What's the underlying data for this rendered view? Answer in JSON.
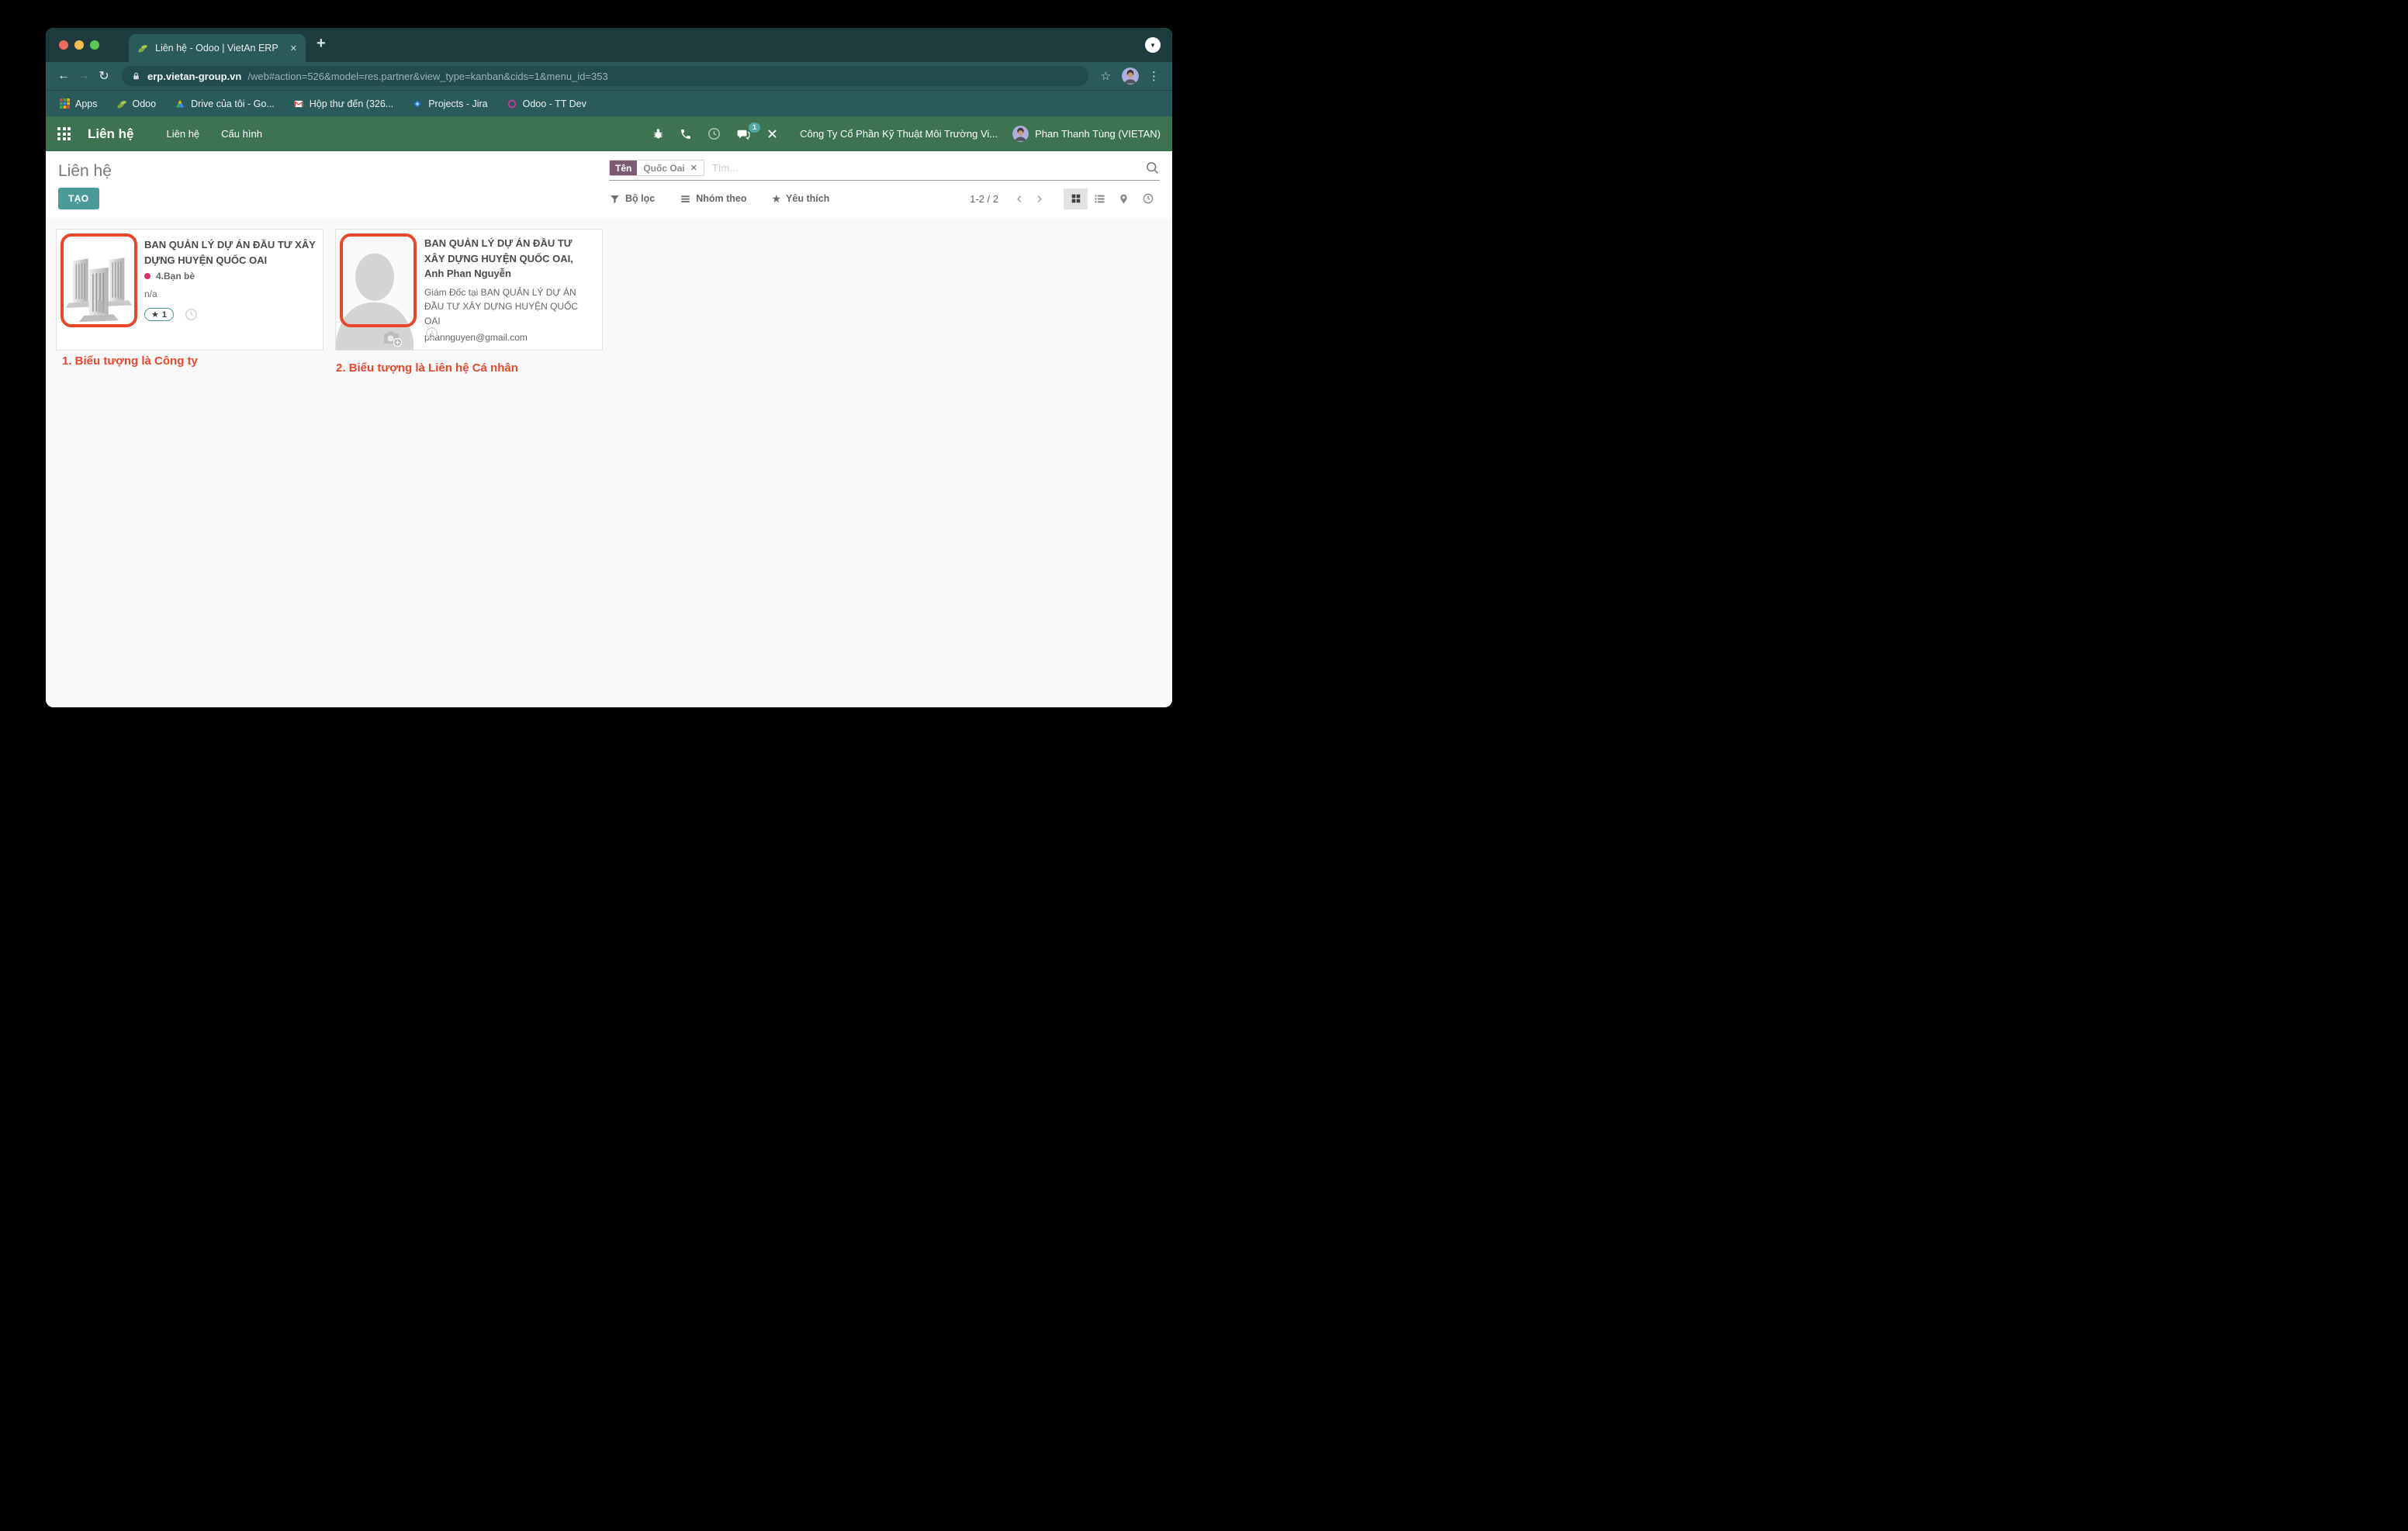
{
  "browser": {
    "tab_title": "Liên hệ - Odoo | VietAn ERP",
    "url_domain": "erp.vietan-group.vn",
    "url_path": "/web#action=526&model=res.partner&view_type=kanban&cids=1&menu_id=353",
    "bookmarks": [
      {
        "label": "Apps",
        "icon": "apps-grid-icon"
      },
      {
        "label": "Odoo",
        "icon": "leaf-icon"
      },
      {
        "label": "Drive của tôi - Go...",
        "icon": "drive-icon"
      },
      {
        "label": "Hộp thư đến (326...",
        "icon": "gmail-icon"
      },
      {
        "label": "Projects - Jira",
        "icon": "jira-icon"
      },
      {
        "label": "Odoo - TT Dev",
        "icon": "ring-icon"
      }
    ]
  },
  "nav": {
    "app_name": "Liên hệ",
    "menu_items": [
      {
        "label": "Liên hệ"
      },
      {
        "label": "Cấu hình"
      }
    ],
    "message_badge": "1",
    "company": "Công Ty Cổ Phần Kỹ Thuật Môi Trường Vi...",
    "user": "Phan Thanh Tùng (VIETAN)"
  },
  "page": {
    "title": "Liên hệ",
    "create_label": "TẠO",
    "search": {
      "facet_label": "Tên",
      "facet_value": "Quốc Oai",
      "placeholder": "Tìm..."
    },
    "controls": {
      "filters": "Bộ lọc",
      "group_by": "Nhóm theo",
      "favorites": "Yêu thích"
    },
    "pager": {
      "range": "1-2 / 2"
    }
  },
  "cards": [
    {
      "type": "company",
      "title": "BAN QUẢN LÝ DỰ ÁN ĐẦU TƯ XÂY DỰNG HUYỆN QUỐC OAI",
      "category": "4.Bạn bè",
      "detail": "n/a",
      "star_count": "1"
    },
    {
      "type": "person",
      "title": "BAN QUẢN LÝ DỰ ÁN ĐẦU TƯ XÂY DỰNG HUYỆN QUỐC OAI, Anh Phan Nguyễn",
      "subtitle": "Giám Đốc tại BAN QUẢN LÝ DỰ ÁN ĐẦU TƯ XÂY DỰNG HUYỆN QUỐC OAI",
      "email": "phannguyen@gmail.com"
    }
  ],
  "annotations": [
    {
      "text": "1. Biểu tượng là Công ty"
    },
    {
      "text": "2. Biểu tượng là Liên hệ Cá nhân"
    }
  ],
  "icons": {
    "close": "✕",
    "plus": "+",
    "arrow_back": "←",
    "arrow_forward": "→",
    "reload": "↻",
    "tab_menu": "▼",
    "star_outline": "☆",
    "dots_vertical": "⋮",
    "star_filled": "★",
    "chevron_left": "‹",
    "chevron_right": "›"
  },
  "colors": {
    "accent_teal": "#4a9b98",
    "odoo_green": "#3d7351",
    "facet_purple": "#7c5a73",
    "annotation_red": "#e8472b",
    "category_dot": "#d6336c",
    "badge_teal": "#4fa8a4"
  }
}
